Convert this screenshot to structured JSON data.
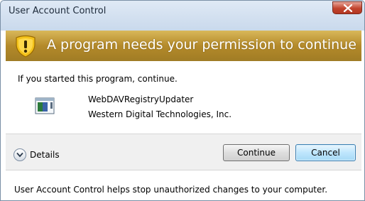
{
  "window": {
    "title": "User Account Control",
    "close_icon": "close-x-icon"
  },
  "banner": {
    "icon": "uac-shield-warning-icon",
    "message": "A program needs your permission to continue",
    "color": "#b48a2a"
  },
  "body": {
    "intro": "If you started this program, continue.",
    "program_icon": "application-icon",
    "program_name": "WebDAVRegistryUpdater",
    "publisher": "Western Digital Technologies, Inc."
  },
  "actions": {
    "details_icon": "chevron-down-icon",
    "details_label": "Details",
    "continue_label": "Continue",
    "cancel_label": "Cancel"
  },
  "footer": {
    "text": "User Account Control helps stop unauthorized changes to your computer."
  }
}
